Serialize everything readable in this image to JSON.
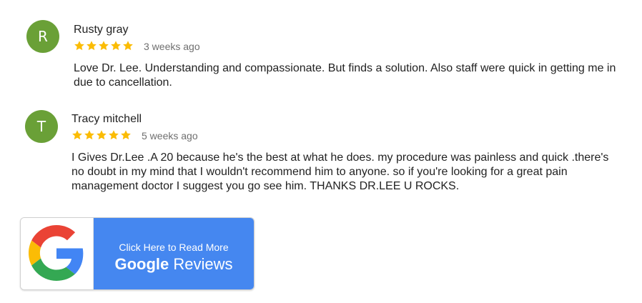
{
  "reviews": [
    {
      "initial": "R",
      "name": "Rusty gray",
      "stars": 5,
      "time": "3 weeks ago",
      "text": "Love Dr. Lee. Understanding and compassionate. But finds a solution. Also staff were quick in getting me in due to cancellation."
    },
    {
      "initial": "T",
      "name": "Tracy mitchell",
      "stars": 5,
      "time": "5 weeks ago",
      "text": "I Gives Dr.Lee .A 20 because he's the best at what he does. my procedure was painless and quick .there's no doubt in my mind that I wouldn't recommend him to anyone. so if you're looking for a great pain management doctor I suggest you go see him. THANKS DR.LEE U ROCKS."
    }
  ],
  "badge": {
    "line1": "Click Here to Read More",
    "brand": "Google",
    "suffix": "Reviews"
  },
  "colors": {
    "avatar": "#6aa037",
    "star": "#fbbc04",
    "badge_blue": "#4587f0",
    "google_red": "#ea4335",
    "google_yellow": "#fbbc05",
    "google_green": "#34a853",
    "google_blue": "#4285f4"
  }
}
